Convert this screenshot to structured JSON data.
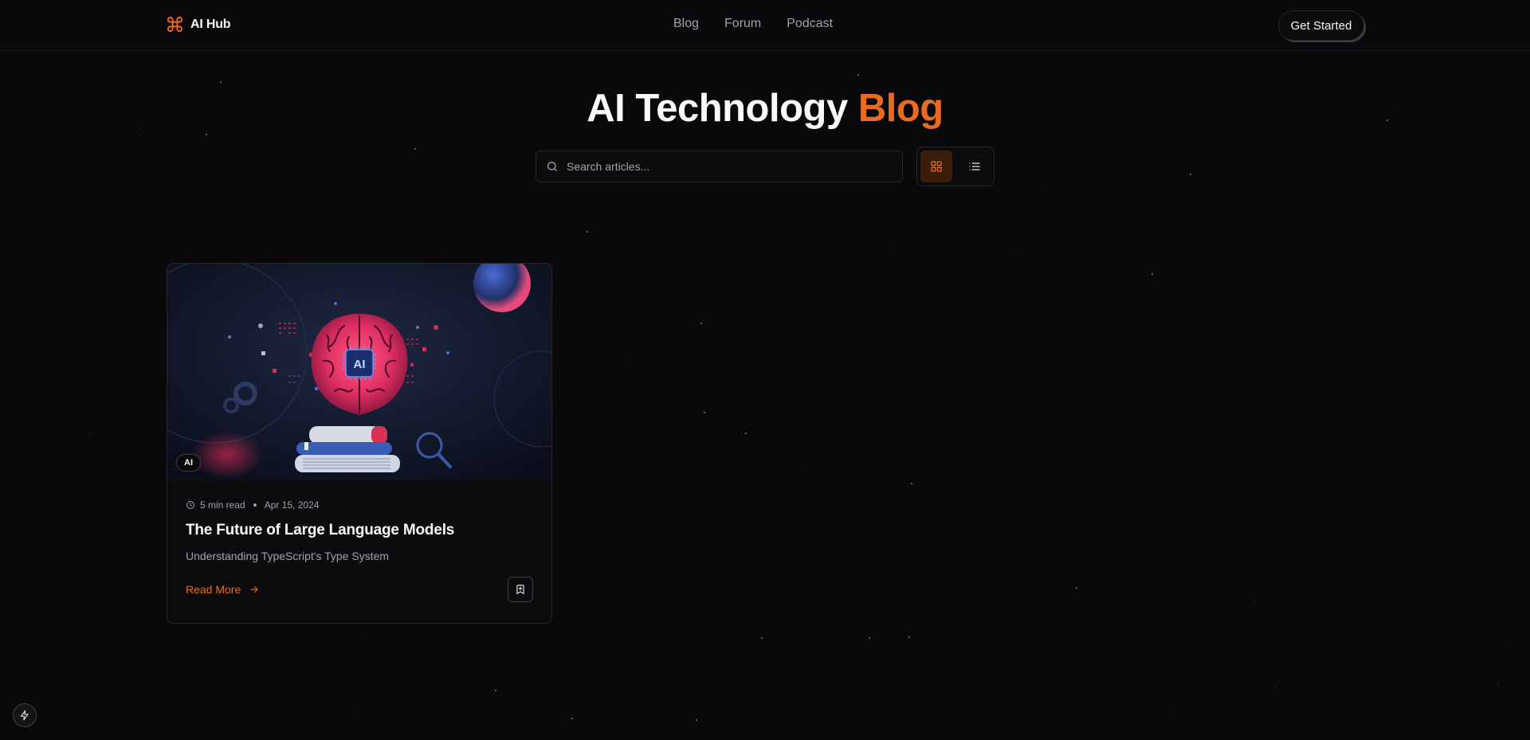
{
  "header": {
    "brand": "AI Hub",
    "nav": [
      "Blog",
      "Forum",
      "Podcast"
    ],
    "cta_label": "Get Started"
  },
  "hero": {
    "title_main": "AI Technology",
    "title_accent": "Blog"
  },
  "search": {
    "placeholder": "Search articles..."
  },
  "view_toggle": {
    "active": "grid"
  },
  "posts": [
    {
      "tag": "AI",
      "read_time": "5 min read",
      "date": "Apr 15, 2024",
      "title": "The Future of Large Language Models",
      "subtitle": "Understanding TypeScript's Type System",
      "read_more": "Read More",
      "image_badge": "AI"
    }
  ],
  "colors": {
    "accent": "#ea6a1f",
    "background": "#09090b",
    "border": "#27272a",
    "muted_text": "#a1a1aa"
  },
  "icons": {
    "brand": "command-icon",
    "search": "search-icon",
    "grid": "grid-icon",
    "list": "list-icon",
    "clock": "clock-icon",
    "arrow": "arrow-right-icon",
    "bookmark": "bookmark-plus-icon",
    "corner": "lightning-icon"
  }
}
